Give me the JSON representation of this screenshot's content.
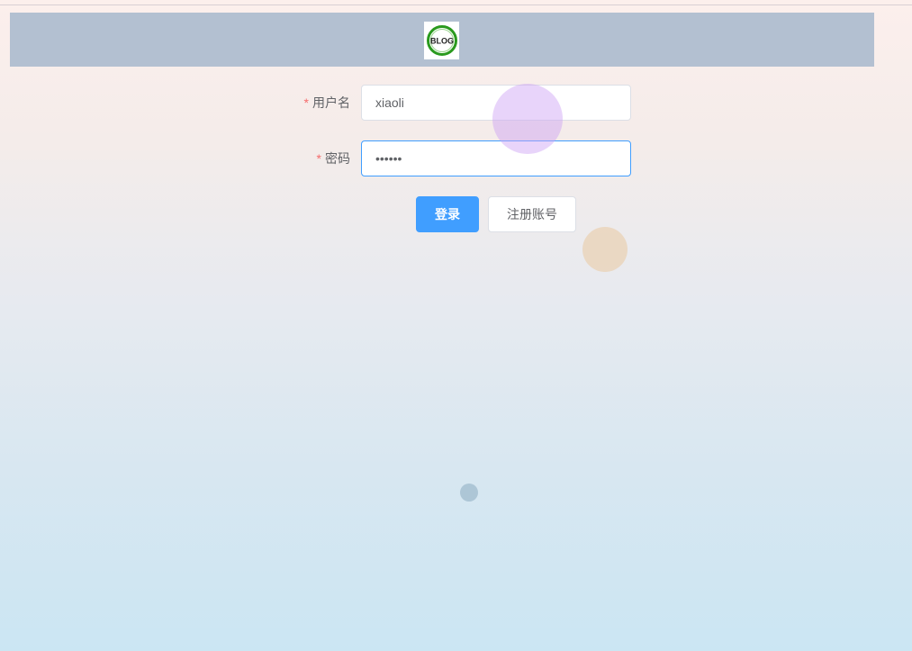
{
  "header": {
    "logo_text": "BLOG",
    "background_color": "#b3c0d1"
  },
  "form": {
    "username": {
      "required_mark": "*",
      "label": "用户名",
      "value": "xiaoli"
    },
    "password": {
      "required_mark": "*",
      "label": "密码",
      "value": "••••••"
    }
  },
  "buttons": {
    "login_label": "登录",
    "register_label": "注册账号"
  },
  "colors": {
    "primary": "#409eff",
    "required": "#f56c6c",
    "text": "#606266"
  }
}
